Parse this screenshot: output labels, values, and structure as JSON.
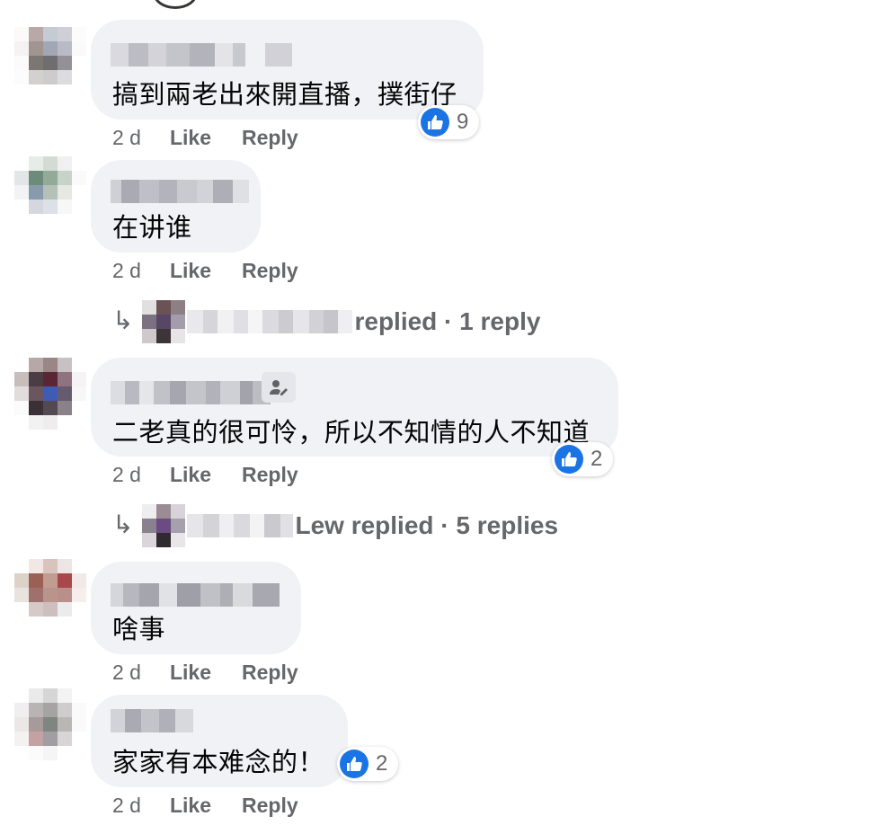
{
  "comments": [
    {
      "text": "搞到兩老出來開直播，撲街仔",
      "time": "2 d",
      "like_label": "Like",
      "reply_label": "Reply",
      "reactions": "9"
    },
    {
      "text": "在讲谁",
      "time": "2 d",
      "like_label": "Like",
      "reply_label": "Reply",
      "replies_summary": "replied · 1 reply"
    },
    {
      "text": "二老真的很可怜，所以不知情的人不知道",
      "time": "2 d",
      "like_label": "Like",
      "reply_label": "Reply",
      "reactions": "2",
      "replies_summary": "Lew replied · 5 replies"
    },
    {
      "text": "啥事",
      "time": "2 d",
      "like_label": "Like",
      "reply_label": "Reply"
    },
    {
      "text": "家家有本难念的！",
      "time": "2 d",
      "like_label": "Like",
      "reply_label": "Reply",
      "reactions": "2"
    }
  ],
  "icons": {
    "reaction": "like-thumb-icon",
    "reply_arrow": "reply-arrow-icon",
    "badge": "user-edit-badge-icon"
  },
  "colors": {
    "bubble": "#f0f2f5",
    "like_blue": "#1b74e4",
    "meta_gray": "#65676b",
    "text": "#050505"
  }
}
